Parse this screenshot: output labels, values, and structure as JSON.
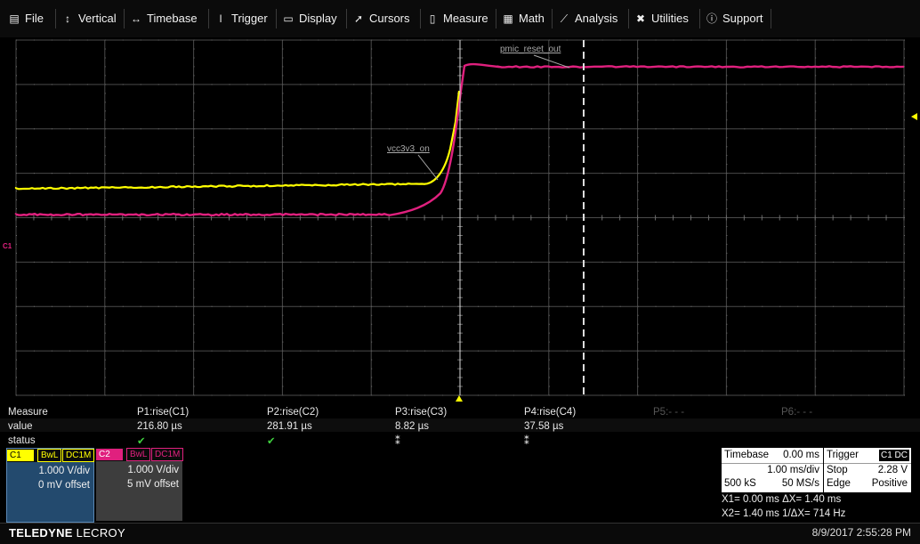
{
  "menu": [
    {
      "label": "File",
      "icon": "file-icon"
    },
    {
      "label": "Vertical",
      "icon": "vertical-arrows-icon"
    },
    {
      "label": "Timebase",
      "icon": "horizontal-arrows-icon"
    },
    {
      "label": "Trigger",
      "icon": "trigger-icon"
    },
    {
      "label": "Display",
      "icon": "display-icon"
    },
    {
      "label": "Cursors",
      "icon": "cursor-icon"
    },
    {
      "label": "Measure",
      "icon": "measure-icon"
    },
    {
      "label": "Math",
      "icon": "calculator-icon"
    },
    {
      "label": "Analysis",
      "icon": "analysis-chart-icon"
    },
    {
      "label": "Utilities",
      "icon": "wrench-icon"
    },
    {
      "label": "Support",
      "icon": "info-icon"
    }
  ],
  "waveform": {
    "trace_labels": {
      "c1": "vcc3v3_on",
      "c2": "pmic_reset_out"
    },
    "channel_edge_label": "C1",
    "colors": {
      "c1": "#ffff00",
      "c2": "#e0207e",
      "grid": "#4a4a4a",
      "cursor": "#dddddd"
    }
  },
  "measure": {
    "row_labels": [
      "Measure",
      "value",
      "status"
    ],
    "params": [
      {
        "name": "P1:rise(C1)",
        "value": "216.80 µs",
        "status": "✔"
      },
      {
        "name": "P2:rise(C2)",
        "value": "281.91 µs",
        "status": "✔"
      },
      {
        "name": "P3:rise(C3)",
        "value": "8.82 µs",
        "status": "⁑"
      },
      {
        "name": "P4:rise(C4)",
        "value": "37.58 µs",
        "status": "⁑"
      },
      {
        "name": "P5:- - -",
        "value": "",
        "status": ""
      },
      {
        "name": "P6:- - -",
        "value": "",
        "status": ""
      }
    ]
  },
  "channels": [
    {
      "name": "C1",
      "bw": "BwL",
      "coupling": "DC1M",
      "vdiv": "1.000 V/div",
      "offset": "0 mV offset"
    },
    {
      "name": "C2",
      "bw": "BwL",
      "coupling": "DC1M",
      "vdiv": "1.000 V/div",
      "offset": "5 mV offset"
    }
  ],
  "timebase": {
    "title": "Timebase",
    "delay": "0.00 ms",
    "tdiv": "1.00 ms/div",
    "samples": "500 kS",
    "rate": "50 MS/s"
  },
  "trigger": {
    "title": "Trigger",
    "tag": "C1 DC",
    "mode": "Stop",
    "level": "2.28 V",
    "type": "Edge",
    "slope": "Positive"
  },
  "cursor_info": {
    "line1": "X1= 0.00 ms ΔX=      1.40 ms",
    "line2": "X2= 1.40 ms 1/ΔX= 714 Hz"
  },
  "footer": {
    "brand_bold": "TELEDYNE",
    "brand_rest": " LECROY",
    "datetime": "8/9/2017 2:55:28 PM"
  }
}
